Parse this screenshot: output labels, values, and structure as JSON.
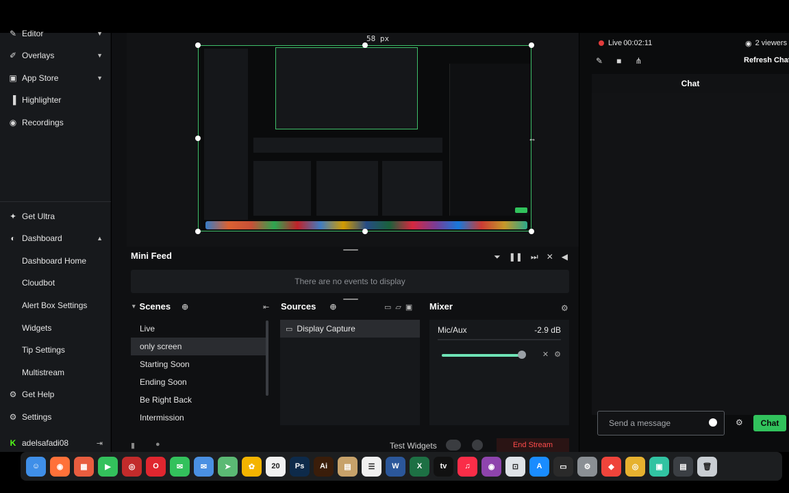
{
  "sidebar": {
    "items": [
      {
        "label": "Editor",
        "icon": "palette-icon",
        "chevron": "chevron-down-icon"
      },
      {
        "label": "Overlays",
        "icon": "brush-icon",
        "chevron": "chevron-down-icon"
      },
      {
        "label": "App Store",
        "icon": "store-icon",
        "chevron": "chevron-down-icon"
      },
      {
        "label": "Highlighter",
        "icon": "highlighter-icon"
      },
      {
        "label": "Recordings",
        "icon": "record-icon"
      }
    ],
    "bottom_items": [
      {
        "label": "Get Ultra",
        "icon": "ultra-icon"
      },
      {
        "label": "Dashboard",
        "icon": "dashboard-icon",
        "chevron": "chevron-up-icon"
      },
      {
        "label": "Dashboard Home"
      },
      {
        "label": "Cloudbot"
      },
      {
        "label": "Alert Box Settings"
      },
      {
        "label": "Widgets"
      },
      {
        "label": "Tip Settings"
      },
      {
        "label": "Multistream"
      },
      {
        "label": "Get Help",
        "icon": "help-icon"
      },
      {
        "label": "Settings",
        "icon": "gear-icon"
      },
      {
        "label": "adelsafadi08",
        "icon": "kick-icon"
      }
    ]
  },
  "preview": {
    "px_label": "58 px"
  },
  "mini_feed": {
    "title": "Mini Feed",
    "empty_text": "There are no events to display"
  },
  "scenes": {
    "title": "Scenes",
    "items": [
      "Live",
      "only screen",
      "Starting Soon",
      "Ending Soon",
      "Be Right Back",
      "Intermission"
    ],
    "active_index": 1
  },
  "sources": {
    "title": "Sources",
    "items": [
      "Display Capture"
    ]
  },
  "mixer": {
    "title": "Mixer",
    "channel": "Mic/Aux",
    "level": "-2.9 dB",
    "volume_fraction": 0.86
  },
  "footer": {
    "test_widgets": "Test Widgets",
    "end_stream": "End Stream"
  },
  "stream": {
    "live_label": "Live",
    "elapsed": "00:02:11",
    "viewers": "2 viewers",
    "refresh_chat": "Refresh Chat"
  },
  "chat": {
    "title": "Chat",
    "placeholder": "Send a message",
    "button": "Chat"
  },
  "dock": [
    {
      "name": "finder-icon",
      "color": "#3f8fe8",
      "glyph": "☺"
    },
    {
      "name": "firefox-icon",
      "color": "#ff7139",
      "glyph": "◉"
    },
    {
      "name": "launchpad-icon",
      "color": "#e85d3f",
      "glyph": "▦"
    },
    {
      "name": "facetime-icon",
      "color": "#33c15c",
      "glyph": "▶"
    },
    {
      "name": "recorder-icon",
      "color": "#c22b2b",
      "glyph": "◎"
    },
    {
      "name": "opera-icon",
      "color": "#e0262f",
      "glyph": "O"
    },
    {
      "name": "messages-icon",
      "color": "#33c15c",
      "glyph": "✉"
    },
    {
      "name": "mail-icon",
      "color": "#4a90e2",
      "glyph": "✉"
    },
    {
      "name": "maps-icon",
      "color": "#5bb974",
      "glyph": "➤"
    },
    {
      "name": "photos-icon",
      "color": "#f4b400",
      "glyph": "✿"
    },
    {
      "name": "calendar-icon",
      "color": "#f1f1f1",
      "glyph": "20"
    },
    {
      "name": "photoshop-icon",
      "color": "#0d2a4a",
      "glyph": "Ps"
    },
    {
      "name": "illustrator-icon",
      "color": "#3a1d0a",
      "glyph": "Ai"
    },
    {
      "name": "notes-icon",
      "color": "#c7a26a",
      "glyph": "▤"
    },
    {
      "name": "reminders-icon",
      "color": "#f0f0f0",
      "glyph": "☰"
    },
    {
      "name": "word-icon",
      "color": "#2b579a",
      "glyph": "W"
    },
    {
      "name": "excel-icon",
      "color": "#1d7044",
      "glyph": "X"
    },
    {
      "name": "appletv-icon",
      "color": "#111111",
      "glyph": "tv"
    },
    {
      "name": "music-icon",
      "color": "#fa2d48",
      "glyph": "♫"
    },
    {
      "name": "podcasts-icon",
      "color": "#8e44ad",
      "glyph": "◉"
    },
    {
      "name": "obs-icon",
      "color": "#dfe3e8",
      "glyph": "⊡"
    },
    {
      "name": "appstore-icon",
      "color": "#1a8cff",
      "glyph": "A"
    },
    {
      "name": "terminal-icon",
      "color": "#2a2a2a",
      "glyph": "▭"
    },
    {
      "name": "system-settings-icon",
      "color": "#8a8f94",
      "glyph": "⚙"
    },
    {
      "name": "anydesk-icon",
      "color": "#ef443b",
      "glyph": "◆"
    },
    {
      "name": "chrome-icon",
      "color": "#e6b12f",
      "glyph": "◎"
    },
    {
      "name": "streamlabs-icon",
      "color": "#31c3a2",
      "glyph": "▣"
    },
    {
      "name": "screenshot-thumbnail-icon",
      "color": "#3b3f44",
      "glyph": "▤"
    },
    {
      "name": "trash-icon",
      "color": "#c9ced3",
      "glyph": "🗑"
    }
  ]
}
